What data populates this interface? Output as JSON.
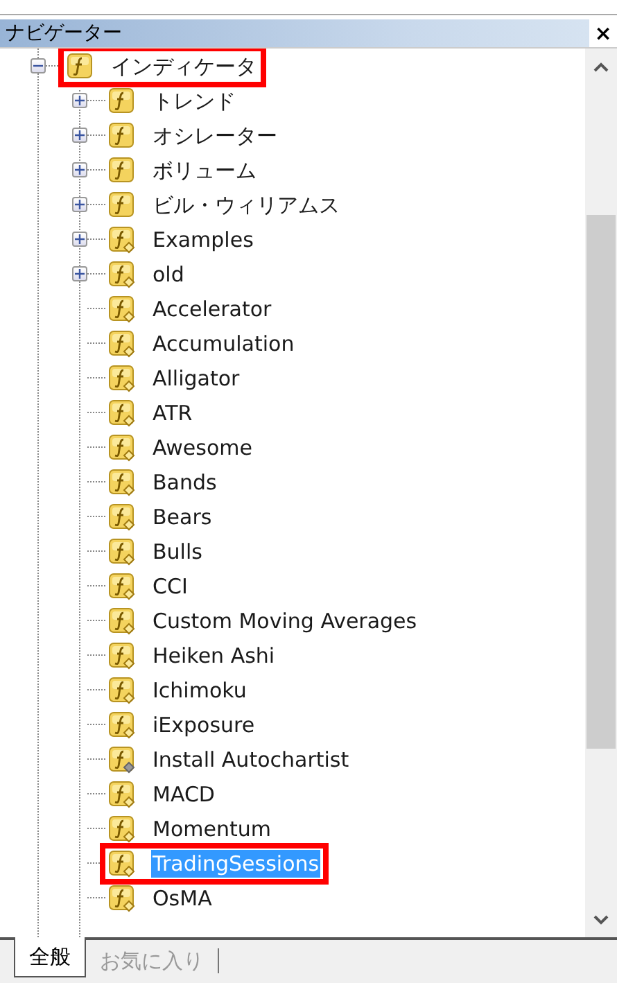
{
  "panel": {
    "title": "ナビゲーター",
    "close": "×"
  },
  "tree": {
    "label": "インディケータ",
    "kind": "folder",
    "expanded": true,
    "selected": false,
    "highlighted": true,
    "children": [
      {
        "label": "トレンド",
        "kind": "folder",
        "expanded": false,
        "selected": false
      },
      {
        "label": "オシレーター",
        "kind": "folder",
        "expanded": false,
        "selected": false
      },
      {
        "label": "ボリューム",
        "kind": "folder",
        "expanded": false,
        "selected": false
      },
      {
        "label": "ビル・ウィリアムス",
        "kind": "folder",
        "expanded": false,
        "selected": false
      },
      {
        "label": "Examples",
        "kind": "indicator",
        "expanded": false,
        "selected": false
      },
      {
        "label": "old",
        "kind": "indicator",
        "expanded": false,
        "selected": false
      },
      {
        "label": "Accelerator",
        "kind": "indicator",
        "selected": false
      },
      {
        "label": "Accumulation",
        "kind": "indicator",
        "selected": false
      },
      {
        "label": "Alligator",
        "kind": "indicator",
        "selected": false
      },
      {
        "label": "ATR",
        "kind": "indicator",
        "selected": false
      },
      {
        "label": "Awesome",
        "kind": "indicator",
        "selected": false
      },
      {
        "label": "Bands",
        "kind": "indicator",
        "selected": false
      },
      {
        "label": "Bears",
        "kind": "indicator",
        "selected": false
      },
      {
        "label": "Bulls",
        "kind": "indicator",
        "selected": false
      },
      {
        "label": "CCI",
        "kind": "indicator",
        "selected": false
      },
      {
        "label": "Custom Moving Averages",
        "kind": "indicator",
        "selected": false
      },
      {
        "label": "Heiken Ashi",
        "kind": "indicator",
        "selected": false
      },
      {
        "label": "Ichimoku",
        "kind": "indicator",
        "selected": false
      },
      {
        "label": "iExposure",
        "kind": "indicator",
        "selected": false
      },
      {
        "label": "Install Autochartist",
        "kind": "script",
        "selected": false
      },
      {
        "label": "MACD",
        "kind": "indicator",
        "selected": false
      },
      {
        "label": "Momentum",
        "kind": "indicator",
        "selected": false
      },
      {
        "label": "TradingSessions",
        "kind": "indicator",
        "selected": true,
        "highlighted": true
      },
      {
        "label": "OsMA",
        "kind": "indicator",
        "selected": false
      }
    ]
  },
  "tabs": [
    {
      "label": "全般",
      "selected": true
    },
    {
      "label": "お気に入り",
      "selected": false
    }
  ]
}
